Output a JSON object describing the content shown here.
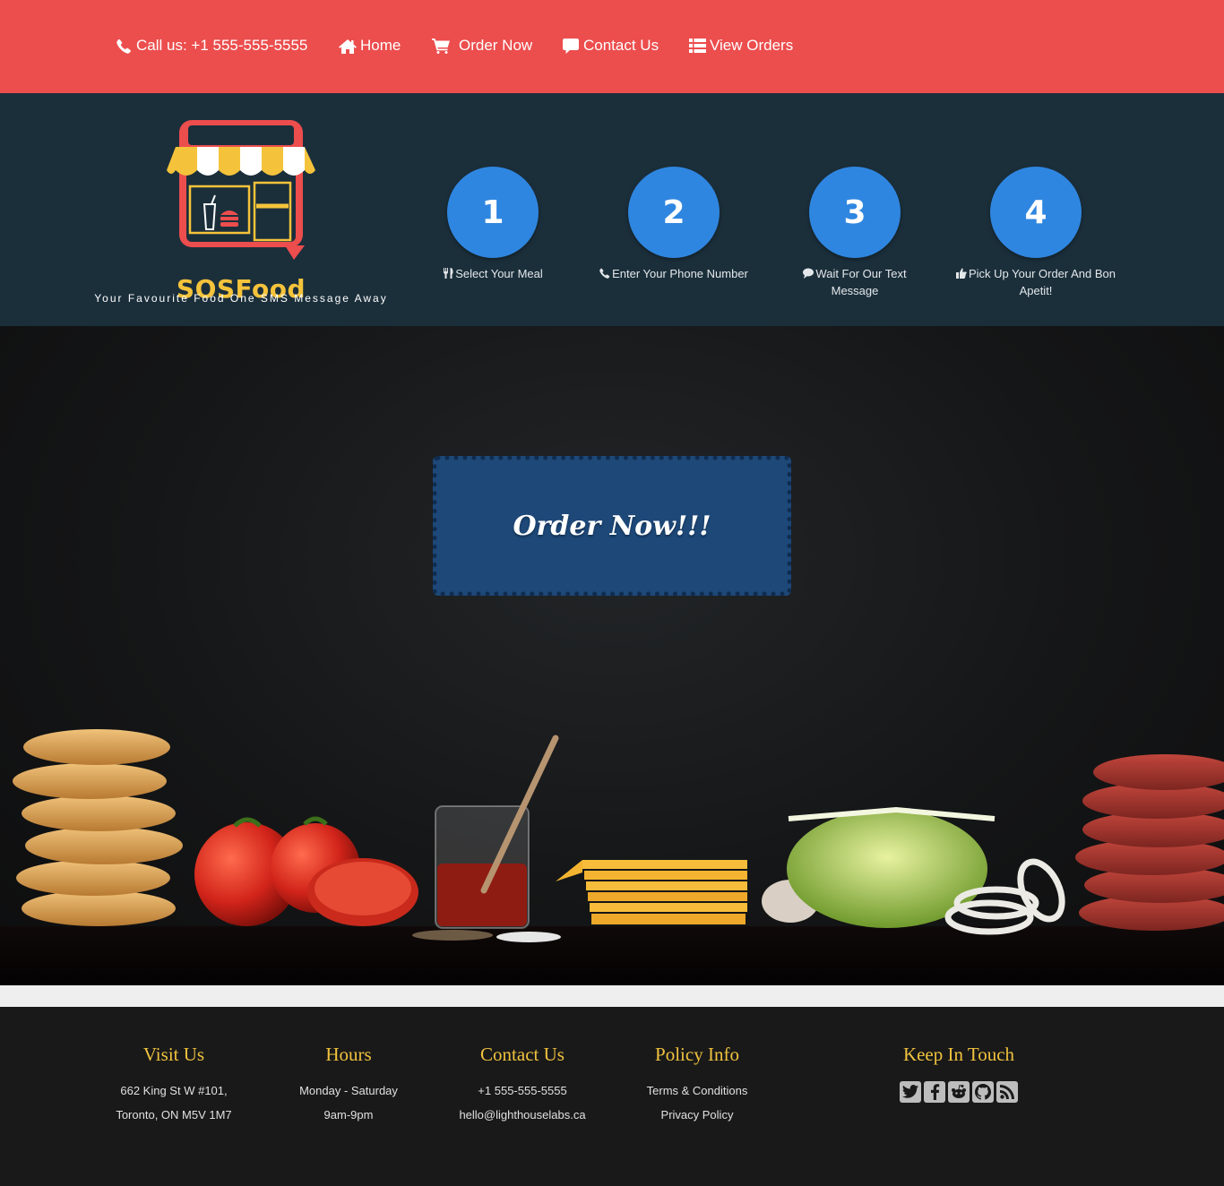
{
  "nav": {
    "items": [
      {
        "label": "Call us: +1 555-555-5555",
        "icon": "phone-icon"
      },
      {
        "label": "Home",
        "icon": "home-icon"
      },
      {
        "label": "Order Now",
        "icon": "cart-icon"
      },
      {
        "label": "Contact Us",
        "icon": "comment-icon"
      },
      {
        "label": "View Orders",
        "icon": "list-icon"
      }
    ]
  },
  "brand": {
    "name": "SOSFood",
    "tagline": "Your Favourite Food One SMS Message Away"
  },
  "steps": [
    {
      "number": "1",
      "label": "Select Your Meal",
      "icon": "utensils-icon"
    },
    {
      "number": "2",
      "label": "Enter Your Phone Number",
      "icon": "phone-icon"
    },
    {
      "number": "3",
      "label": "Wait For Our Text Message",
      "icon": "chat-icon"
    },
    {
      "number": "4",
      "label": "Pick Up Your Order And Bon Apetit!",
      "icon": "thumbs-up-icon"
    }
  ],
  "hero": {
    "cta_label": "Order Now!!!"
  },
  "footer": {
    "visit": {
      "title": "Visit Us",
      "line1": "662 King St W #101,",
      "line2": "Toronto, ON M5V 1M7"
    },
    "hours": {
      "title": "Hours",
      "line1": "Monday - Saturday",
      "line2": "9am-9pm"
    },
    "contact": {
      "title": "Contact Us",
      "line1": "+1 555-555-5555",
      "line2": "hello@lighthouselabs.ca"
    },
    "policy": {
      "title": "Policy Info",
      "line1": "Terms & Conditions",
      "line2": "Privacy Policy"
    },
    "social": {
      "title": "Keep In Touch",
      "icons": [
        "twitter-icon",
        "facebook-icon",
        "reddit-icon",
        "github-icon",
        "rss-icon"
      ]
    }
  },
  "colors": {
    "nav_bg": "#ec4d4d",
    "header_bg": "#1b2f3b",
    "step_circle": "#2f86e0",
    "cta_bg": "#1d4878",
    "footer_bg": "#191919",
    "footer_heading": "#f0c23e",
    "brand_yellow": "#f5c33b"
  }
}
